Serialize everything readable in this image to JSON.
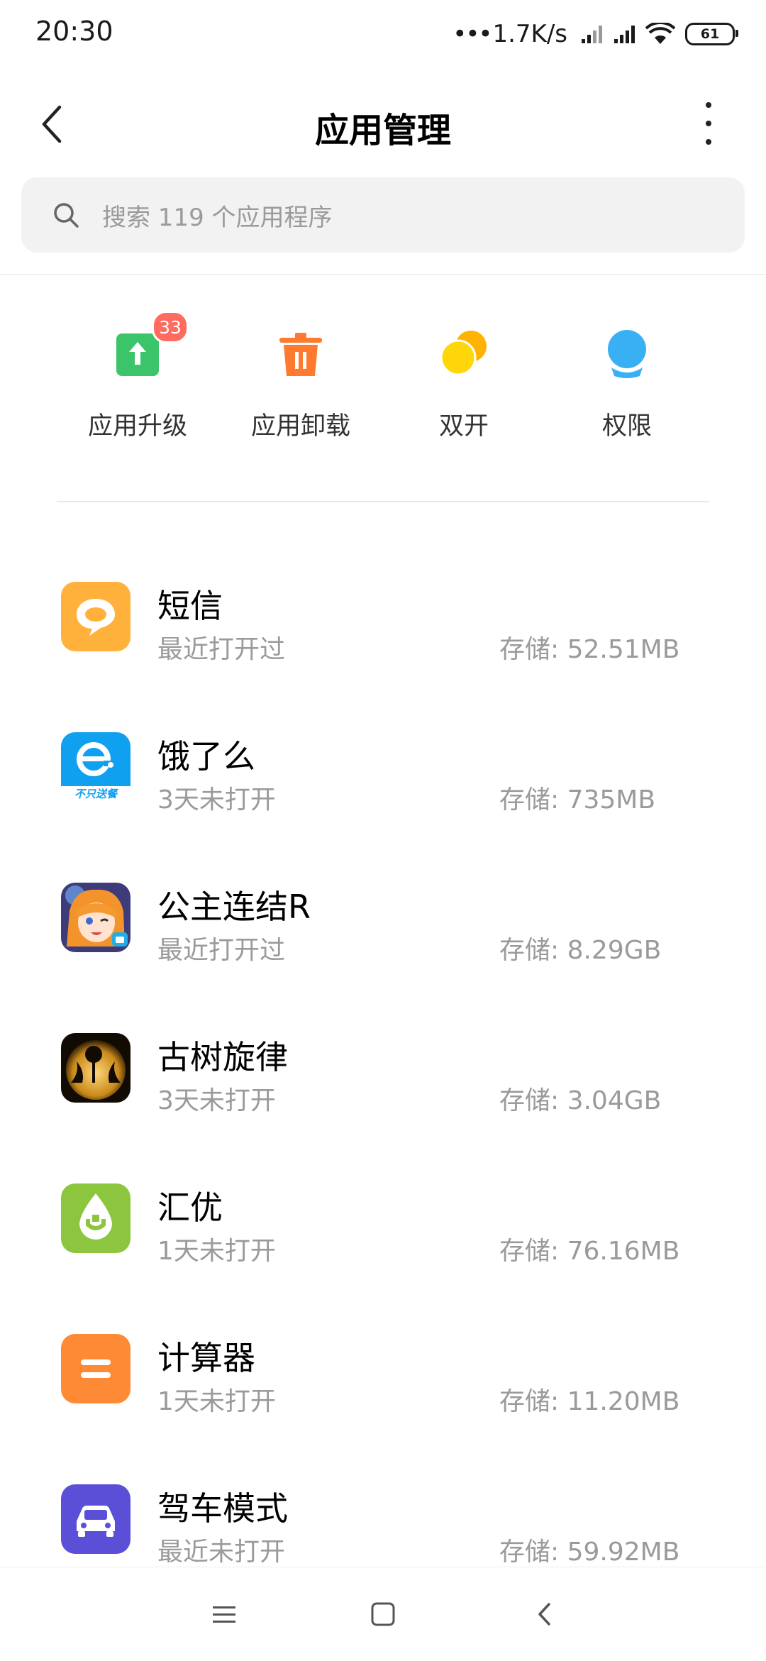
{
  "status_bar": {
    "time": "20:30",
    "dots": "•••",
    "network_speed": "1.7K/s",
    "battery_level": "61",
    "icons": [
      "signal-icon",
      "signal-icon",
      "wifi-icon",
      "battery-icon"
    ]
  },
  "header": {
    "title": "应用管理",
    "back_icon": "chevron-left-icon",
    "more_icon": "more-vertical-icon"
  },
  "search": {
    "placeholder": "搜索 119 个应用程序",
    "icon": "search-icon"
  },
  "quick_actions": [
    {
      "label": "应用升级",
      "icon": "upgrade-icon",
      "badge": "33",
      "color": "#3cc46a"
    },
    {
      "label": "应用卸载",
      "icon": "trash-icon",
      "color": "#ff7a2e"
    },
    {
      "label": "双开",
      "icon": "dual-app-icon",
      "color": "#ffc800"
    },
    {
      "label": "权限",
      "icon": "permission-icon",
      "color": "#3ab0f4"
    }
  ],
  "apps": [
    {
      "name": "短信",
      "status": "最近打开过",
      "storage": "存储: 52.51MB",
      "icon": "message-app-icon"
    },
    {
      "name": "饿了么",
      "status": "3天未打开",
      "storage": "存储: 735MB",
      "icon": "eleme-app-icon",
      "icon_text": "不只送餐"
    },
    {
      "name": "公主连结R",
      "status": "最近打开过",
      "storage": "存储: 8.29GB",
      "icon": "princess-connect-app-icon"
    },
    {
      "name": "古树旋律",
      "status": "3天未打开",
      "storage": "存储: 3.04GB",
      "icon": "deemo-app-icon"
    },
    {
      "name": "汇优",
      "status": "1天未打开",
      "storage": "存储: 76.16MB",
      "icon": "huiyou-app-icon"
    },
    {
      "name": "计算器",
      "status": "1天未打开",
      "storage": "存储: 11.20MB",
      "icon": "calculator-app-icon"
    },
    {
      "name": "驾车模式",
      "status": "最近未打开",
      "storage": "存储: 59.92MB",
      "icon": "car-mode-app-icon"
    }
  ],
  "nav_bar": {
    "icons": [
      "menu-icon",
      "home-icon",
      "back-icon"
    ]
  }
}
